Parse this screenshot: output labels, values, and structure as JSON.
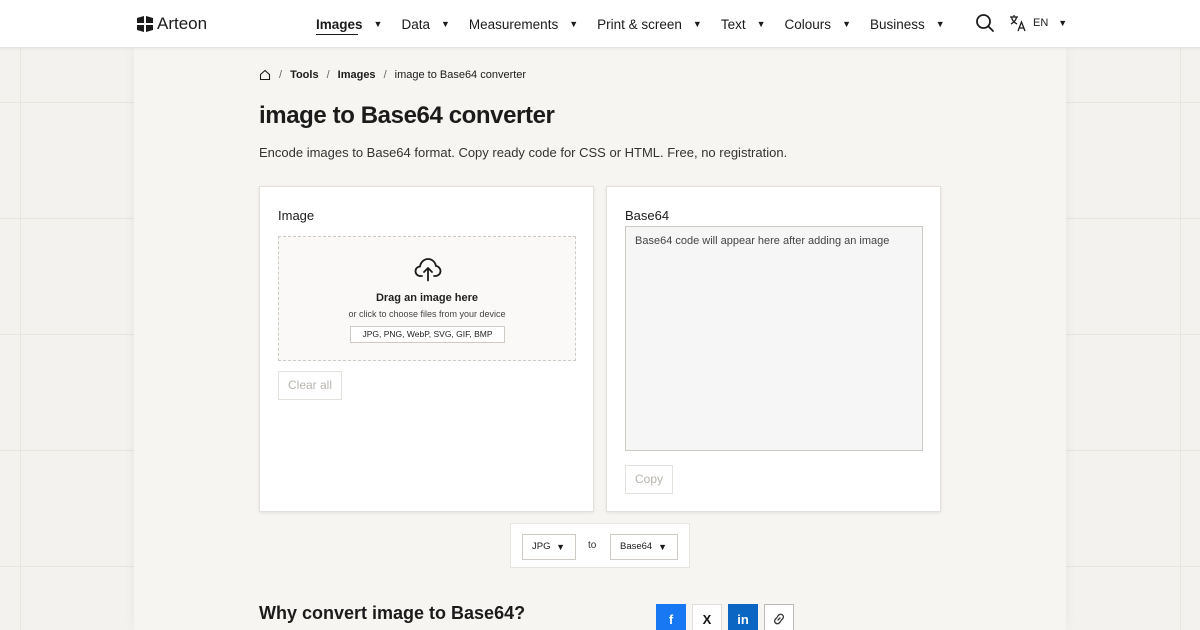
{
  "header": {
    "brand": "Arteon",
    "nav": [
      {
        "label": "Images",
        "active": true
      },
      {
        "label": "Data",
        "active": false
      },
      {
        "label": "Measurements",
        "active": false
      },
      {
        "label": "Print & screen",
        "active": false
      },
      {
        "label": "Text",
        "active": false
      },
      {
        "label": "Colours",
        "active": false
      },
      {
        "label": "Business",
        "active": false
      }
    ],
    "language": "EN",
    "caret": "▼"
  },
  "breadcrumb": {
    "items": [
      "Tools",
      "Images",
      "image to Base64 converter"
    ],
    "separator": "/"
  },
  "page": {
    "title": "image to Base64 converter",
    "description": "Encode images to Base64 format. Copy ready code for CSS or HTML. Free, no registration."
  },
  "image_card": {
    "label": "Image",
    "drop_title": "Drag an image here",
    "drop_subtitle": "or click to choose files from your device",
    "formats": "JPG, PNG, WebP, SVG, GIF, BMP",
    "clear_label": "Clear all"
  },
  "output_card": {
    "label": "Base64",
    "placeholder": "Base64 code will appear here after adding an image",
    "copy_label": "Copy"
  },
  "converter": {
    "from": "JPG",
    "to_label": "to",
    "to": "Base64"
  },
  "section": {
    "why_title": "Why convert image to Base64?"
  },
  "share": {
    "facebook": "f",
    "x": "X",
    "linkedin": "in"
  },
  "colors": {
    "facebook": "#1877f2",
    "linkedin": "#0a66c2",
    "text": "#1b1b1b"
  }
}
